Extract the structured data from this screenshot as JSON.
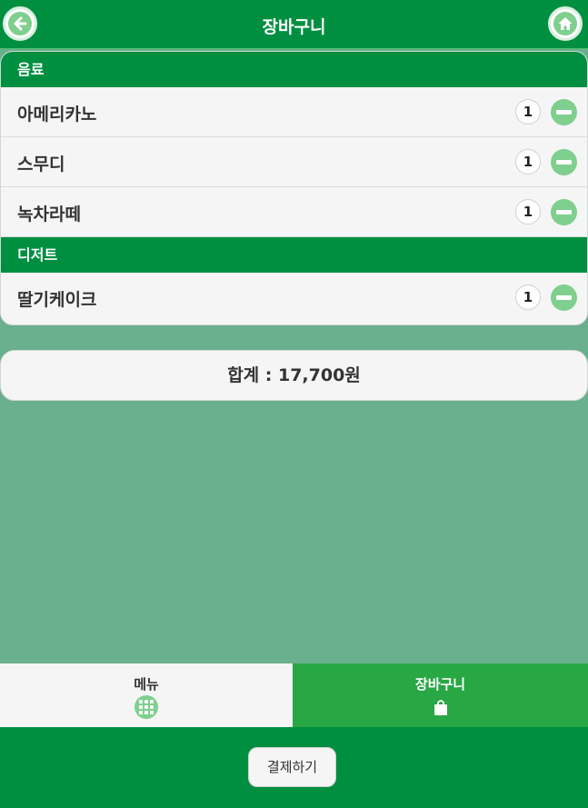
{
  "header": {
    "title": "장바구니",
    "back_icon": "arrow-left-icon",
    "home_icon": "home-icon"
  },
  "cart": {
    "categories": [
      {
        "name": "음료",
        "items": [
          {
            "name": "아메리카노",
            "qty": "1"
          },
          {
            "name": "스무디",
            "qty": "1"
          },
          {
            "name": "녹차라떼",
            "qty": "1"
          }
        ]
      },
      {
        "name": "디저트",
        "items": [
          {
            "name": "딸기케이크",
            "qty": "1"
          }
        ]
      }
    ]
  },
  "total": {
    "text": "합계 : 17,700원"
  },
  "tabs": [
    {
      "label": "메뉴",
      "icon": "grid-icon",
      "active": false
    },
    {
      "label": "장바구니",
      "icon": "shopping-bag-icon",
      "active": true
    }
  ],
  "footer": {
    "pay_label": "결제하기"
  },
  "colors": {
    "primary": "#008f40",
    "active_tab": "#28a745",
    "accent_light": "#7fcf8e",
    "background": "#6aaf8e"
  }
}
